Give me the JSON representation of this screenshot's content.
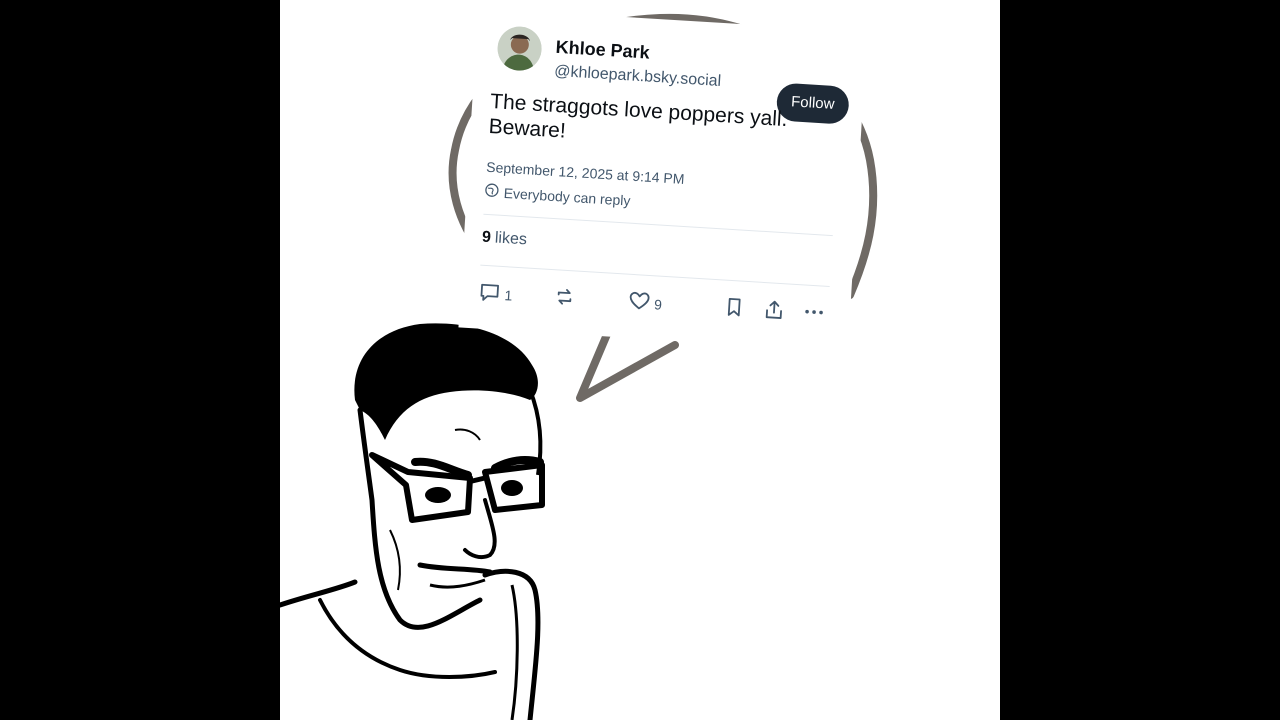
{
  "post": {
    "author_name": "Khloe Park",
    "handle": "@khloepark.bsky.social",
    "follow_label": "Follow",
    "text_line1": "The straggots love poppers yall.",
    "text_line2": "Beware!",
    "timestamp": "September 12, 2025 at 9:14 PM",
    "reply_setting": "Everybody can reply",
    "likes_count": "9",
    "likes_label": "likes",
    "reply_count": "1",
    "like_count_action": "9"
  },
  "icons": {
    "reply": "reply-icon",
    "repost": "repost-icon",
    "like": "heart-icon",
    "bookmark": "bookmark-icon",
    "share": "share-icon",
    "more": "more-icon",
    "reply_setting": "globe-icon"
  },
  "colors": {
    "follow_bg": "#1e2936",
    "secondary_text": "#42576c",
    "bubble_stroke": "#6f6a65"
  }
}
